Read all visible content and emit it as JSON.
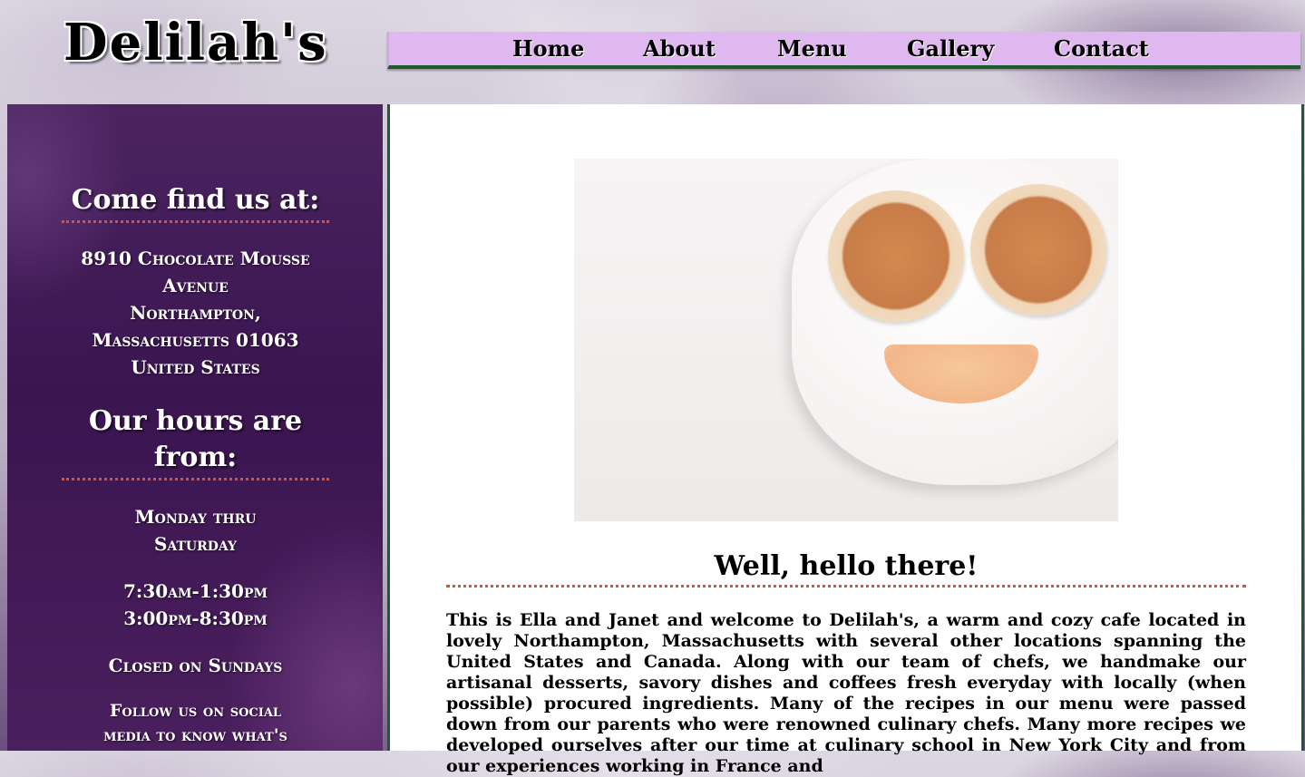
{
  "site": {
    "logo": "Delilah's"
  },
  "nav": {
    "items": [
      {
        "label": "Home"
      },
      {
        "label": "About"
      },
      {
        "label": "Menu"
      },
      {
        "label": "Gallery"
      },
      {
        "label": "Contact"
      }
    ]
  },
  "sidebar": {
    "find_heading": "Come find us at:",
    "address_lines": [
      "8910 Chocolate Mousse",
      "Avenue",
      "Northampton,",
      "Massachusetts 01063",
      "United States"
    ],
    "hours_heading": "Our hours are from:",
    "days": [
      "Monday thru",
      "Saturday"
    ],
    "times": [
      "7:30am-1:30pm",
      "3:00pm-8:30pm"
    ],
    "closed": "Closed on Sundays",
    "follow": [
      "Follow us on social",
      "media to know what's"
    ]
  },
  "main": {
    "hero_image": "smiley-pancake-plate",
    "greeting": "Well, hello there!",
    "intro": "This is Ella and Janet and welcome to Delilah's, a warm and cozy cafe located in lovely Northampton, Massachusetts with several other locations spanning the United States and Canada. Along with our team of chefs, we handmake our artisanal desserts, savory dishes and coffees fresh everyday with locally (when possible) procured ingredients. Many of the recipes in our menu were passed down from our parents who were renowned culinary chefs. Many more recipes we developed ourselves after our time at culinary school in New York City and from our experiences working in France and"
  },
  "colors": {
    "nav_bg": "#dfb8f0",
    "nav_border": "#1d5a2e",
    "sidebar_bg": "#3a1550",
    "divider": "#e0502a"
  }
}
